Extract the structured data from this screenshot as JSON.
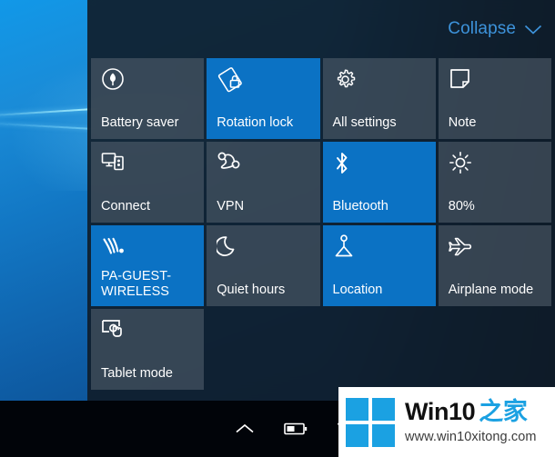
{
  "header": {
    "collapse_label": "Collapse",
    "chevron_icon": "chevron-down-icon",
    "accent_color": "#3d93db"
  },
  "theme": {
    "panel_bg": "rgba(16,28,40,0.90)",
    "tile_off": "rgba(88,101,113,0.55)",
    "tile_on": "#0b72c4",
    "text": "#ffffff"
  },
  "tiles": [
    {
      "label": "Battery saver",
      "icon": "battery-saver-leaf-icon",
      "state": "off"
    },
    {
      "label": "Rotation lock",
      "icon": "rotation-lock-icon",
      "state": "on"
    },
    {
      "label": "All settings",
      "icon": "gear-icon",
      "state": "off"
    },
    {
      "label": "Note",
      "icon": "note-icon",
      "state": "off"
    },
    {
      "label": "Connect",
      "icon": "connect-icon",
      "state": "off"
    },
    {
      "label": "VPN",
      "icon": "vpn-icon",
      "state": "off"
    },
    {
      "label": "Bluetooth",
      "icon": "bluetooth-icon",
      "state": "on"
    },
    {
      "label": "80%",
      "icon": "brightness-icon",
      "state": "off"
    },
    {
      "label": "PA-GUEST-\nWIRELESS",
      "icon": "wifi-icon",
      "state": "on"
    },
    {
      "label": "Quiet hours",
      "icon": "moon-icon",
      "state": "off"
    },
    {
      "label": "Location",
      "icon": "location-pin-icon",
      "state": "on"
    },
    {
      "label": "Airplane mode",
      "icon": "airplane-icon",
      "state": "off"
    },
    {
      "label": "Tablet mode",
      "icon": "tablet-mode-icon",
      "state": "off"
    }
  ],
  "taskbar": {
    "tray_icons": [
      {
        "name": "show-hidden-icons-chevron-up-icon"
      },
      {
        "name": "battery-icon"
      },
      {
        "name": "wifi-icon"
      }
    ]
  },
  "watermark": {
    "title_en": "Win10",
    "title_cn": "之家",
    "url": "www.win10xitong.com",
    "logo_icon": "windows-logo-icon",
    "brand_color": "#1ba1e2"
  }
}
